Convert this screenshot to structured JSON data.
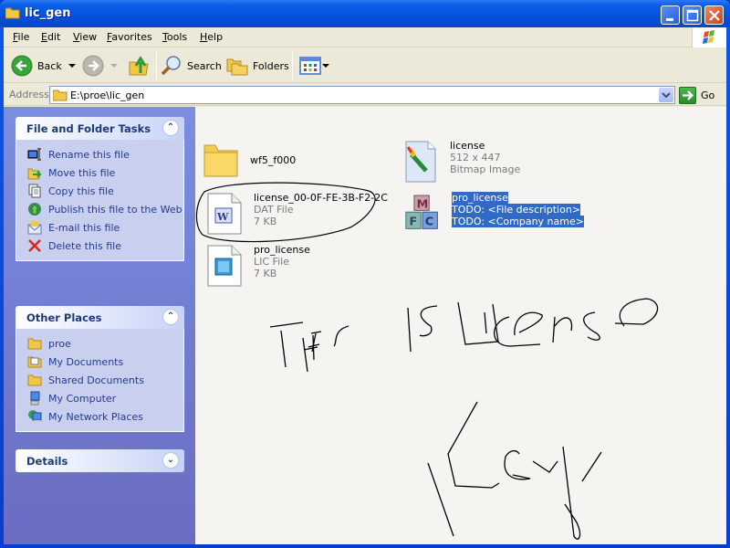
{
  "window": {
    "title": "lic_gen"
  },
  "menu": [
    "File",
    "Edit",
    "View",
    "Favorites",
    "Tools",
    "Help"
  ],
  "toolbar": {
    "back_label": "Back",
    "search_label": "Search",
    "folders_label": "Folders"
  },
  "address": {
    "label": "Address",
    "value": "E:\\proe\\lic_gen",
    "go_label": "Go"
  },
  "sidebar": {
    "file_tasks": {
      "title": "File and Folder Tasks",
      "items": [
        {
          "label": "Rename this file",
          "icon": "rename-icon"
        },
        {
          "label": "Move this file",
          "icon": "move-icon"
        },
        {
          "label": "Copy this file",
          "icon": "copy-icon"
        },
        {
          "label": "Publish this file to the Web",
          "icon": "publish-web-icon"
        },
        {
          "label": "E-mail this file",
          "icon": "email-icon"
        },
        {
          "label": "Delete this file",
          "icon": "delete-icon"
        }
      ]
    },
    "other_places": {
      "title": "Other Places",
      "items": [
        {
          "label": "proe",
          "icon": "folder-icon"
        },
        {
          "label": "My Documents",
          "icon": "my-documents-icon"
        },
        {
          "label": "Shared Documents",
          "icon": "folder-icon"
        },
        {
          "label": "My Computer",
          "icon": "my-computer-icon"
        },
        {
          "label": "My Network Places",
          "icon": "network-places-icon"
        }
      ]
    },
    "details": {
      "title": "Details"
    }
  },
  "files": [
    {
      "name": "wf5_f000",
      "lines": [],
      "icon": "folder-icon",
      "selected": false
    },
    {
      "name": "license",
      "lines": [
        "512 x 447",
        "Bitmap Image"
      ],
      "icon": "bitmap-icon",
      "selected": false
    },
    {
      "name": "license_00-0F-FE-3B-F2-2C",
      "lines": [
        "DAT File",
        "7 KB"
      ],
      "icon": "dat-file-icon",
      "selected": false
    },
    {
      "name": "pro_license",
      "lines": [
        "TODO: <File description>",
        "TODO: <Company name>"
      ],
      "icon": "mfc-app-icon",
      "selected": true
    },
    {
      "name": "pro_license",
      "lines": [
        "LIC File",
        "7 KB"
      ],
      "icon": "lic-file-icon",
      "selected": false
    }
  ],
  "annotation": {
    "text": "This is License Key",
    "color": "#000000"
  },
  "colors": {
    "titlebar": "#0a5ee8",
    "sidebar": "#6a6cc0",
    "selection": "#316ac5",
    "content_bg": "#f5f4f1"
  }
}
